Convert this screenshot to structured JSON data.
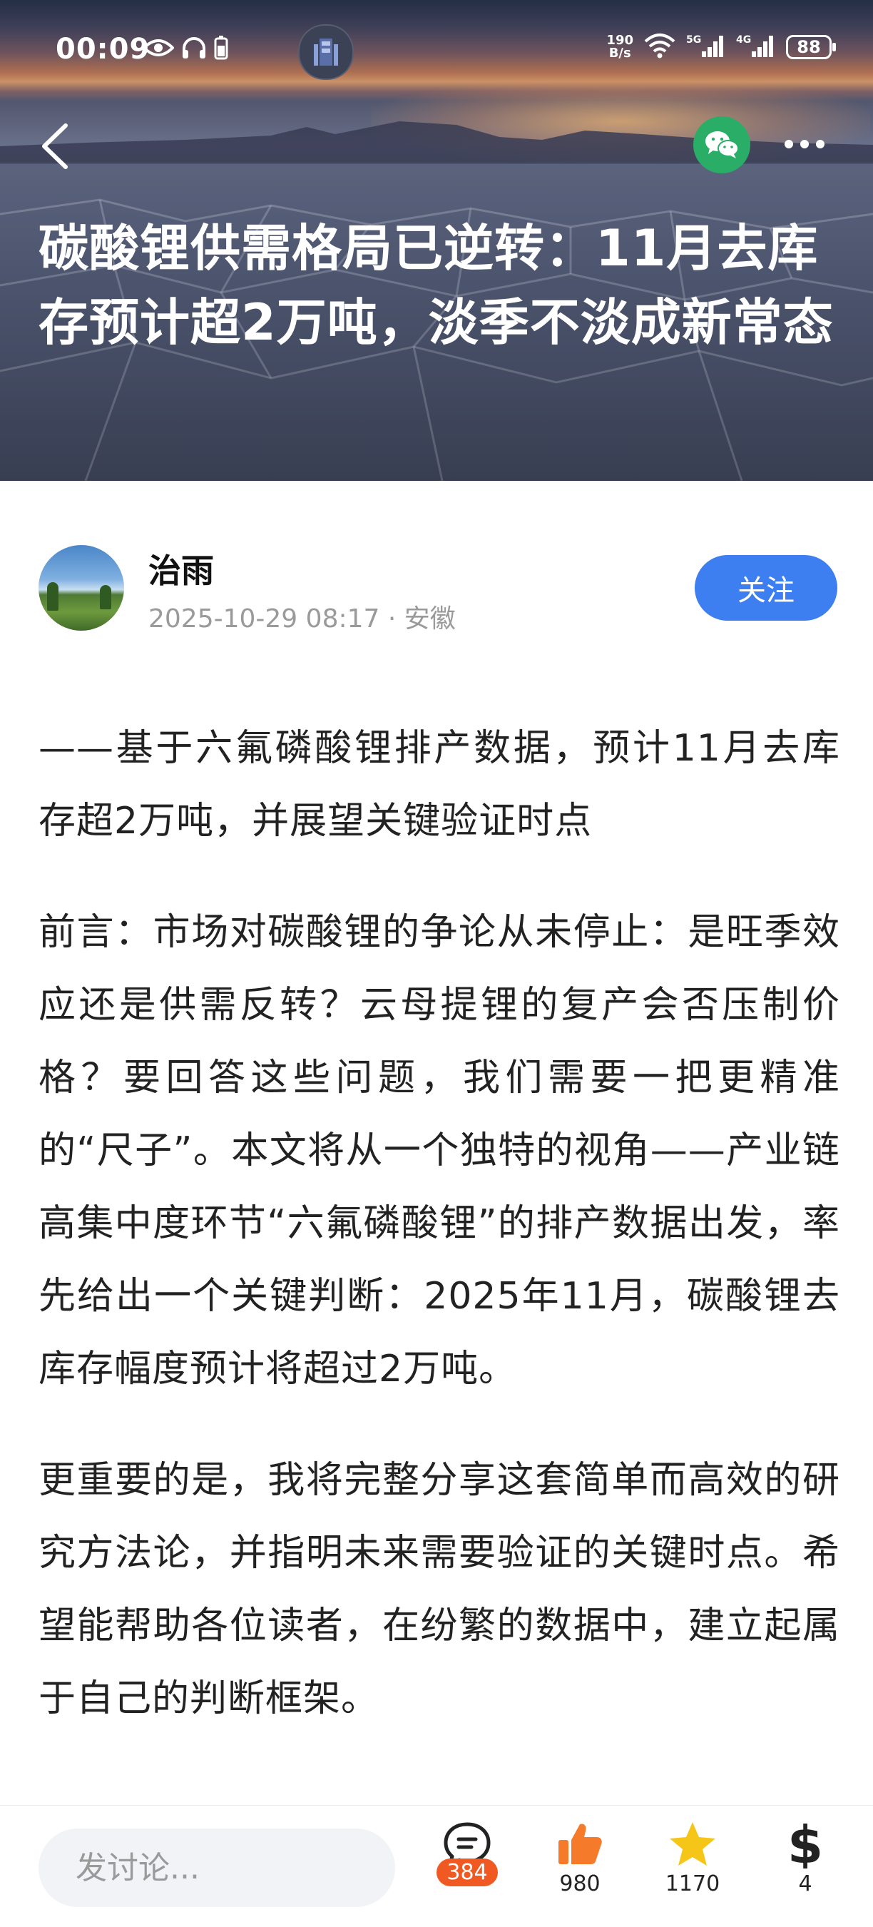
{
  "status_bar": {
    "time": "00:09",
    "net_speed_value": "190",
    "net_speed_unit": "B/s",
    "battery": "88",
    "icons": [
      "eye-icon",
      "headphones-icon",
      "battery-saver-icon",
      "wifi-icon",
      "signal-5g-icon",
      "signal-4g-icon"
    ]
  },
  "header": {
    "title": "碳酸锂供需格局已逆转：11月去库存预计超2万吨，淡季不淡成新常态",
    "back_icon": "chevron-left-icon",
    "share_icon": "wechat-icon",
    "more_icon": "more-dots-icon"
  },
  "author": {
    "name": "治雨",
    "date": "2025-10-29 08:17",
    "separator": "·",
    "location": "安徽",
    "follow_label": "关注"
  },
  "article": {
    "paragraphs": [
      "——基于六氟磷酸锂排产数据，预计11月去库存超2万吨，并展望关键验证时点",
      "前言：市场对碳酸锂的争论从未停止：是旺季效应还是供需反转？云母提锂的复产会否压制价格？要回答这些问题，我们需要一把更精准的“尺子”。本文将从一个独特的视角——产业链高集中度环节“六氟磷酸锂”的排产数据出发，率先给出一个关键判断：2025年11月，碳酸锂去库存幅度预计将超过2万吨。",
      "更重要的是，我将完整分享这套简单而高效的研究方法论，并指明未来需要验证的关键时点。希望能帮助各位读者，在纷繁的数据中，建立起属于自己的判断框架。"
    ]
  },
  "bottom_bar": {
    "comment_placeholder": "发讨论...",
    "comments_count": "384",
    "likes_count": "980",
    "favorites_count": "1170",
    "rewards_count": "4",
    "colors": {
      "comment_badge": "#f05a22",
      "like": "#f57a2a",
      "favorite": "#f5c518",
      "follow": "#3d7ef0",
      "wechat": "#2aae67"
    }
  }
}
